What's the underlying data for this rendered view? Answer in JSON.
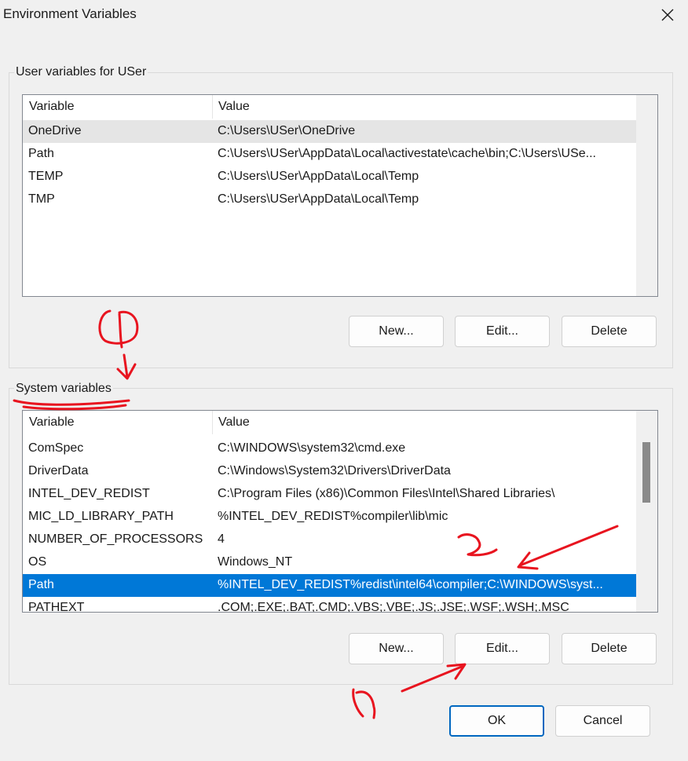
{
  "window": {
    "title": "Environment Variables"
  },
  "user_group": {
    "label": "User variables for USer",
    "columns": [
      "Variable",
      "Value"
    ],
    "rows": [
      {
        "variable": "OneDrive",
        "value": "C:\\Users\\USer\\OneDrive"
      },
      {
        "variable": "Path",
        "value": "C:\\Users\\USer\\AppData\\Local\\activestate\\cache\\bin;C:\\Users\\USe..."
      },
      {
        "variable": "TEMP",
        "value": "C:\\Users\\USer\\AppData\\Local\\Temp"
      },
      {
        "variable": "TMP",
        "value": "C:\\Users\\USer\\AppData\\Local\\Temp"
      }
    ],
    "buttons": {
      "new": "New...",
      "edit": "Edit...",
      "delete": "Delete"
    }
  },
  "system_group": {
    "label": "System variables",
    "columns": [
      "Variable",
      "Value"
    ],
    "rows": [
      {
        "variable": "ComSpec",
        "value": "C:\\WINDOWS\\system32\\cmd.exe"
      },
      {
        "variable": "DriverData",
        "value": "C:\\Windows\\System32\\Drivers\\DriverData"
      },
      {
        "variable": "INTEL_DEV_REDIST",
        "value": "C:\\Program Files (x86)\\Common Files\\Intel\\Shared Libraries\\"
      },
      {
        "variable": "MIC_LD_LIBRARY_PATH",
        "value": "%INTEL_DEV_REDIST%compiler\\lib\\mic"
      },
      {
        "variable": "NUMBER_OF_PROCESSORS",
        "value": "4"
      },
      {
        "variable": "OS",
        "value": "Windows_NT"
      },
      {
        "variable": "Path",
        "value": "%INTEL_DEV_REDIST%redist\\intel64\\compiler;C:\\WINDOWS\\syst..."
      },
      {
        "variable": "PATHEXT",
        "value": ".COM;.EXE;.BAT;.CMD;.VBS;.VBE;.JS;.JSE;.WSF;.WSH;.MSC"
      }
    ],
    "selected_row": "Path",
    "buttons": {
      "new": "New...",
      "edit": "Edit...",
      "delete": "Delete"
    }
  },
  "footer": {
    "ok": "OK",
    "cancel": "Cancel"
  },
  "colors": {
    "selection": "#0078d7",
    "annotation": "#e8141f",
    "primary_border": "#0067c0"
  },
  "icons": {
    "close": "close-icon"
  }
}
